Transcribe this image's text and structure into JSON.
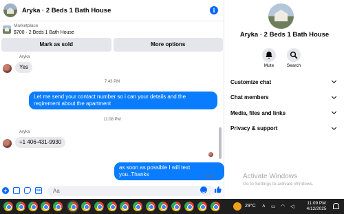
{
  "header": {
    "title": "Aryka · 2 Beds 1 Bath House",
    "info_icon": "info-icon"
  },
  "listing": {
    "source": "Marketplace",
    "summary": "$700 · 2 Beds 1 Bath House"
  },
  "actions": {
    "mark_sold": "Mark as sold",
    "more_options": "More options"
  },
  "messages": {
    "sender_1": "Aryka",
    "msg_1": "Yes",
    "time_1": "7:43 PM",
    "out_1": "Let me send your contact number so i can your details and the reqirement about the apartment",
    "time_2": "11:08 PM",
    "sender_2": "Aryka",
    "msg_2": "+1 406-431-9930",
    "out_2": "as soon as possible I will text you..Thanks",
    "status": "Sent"
  },
  "composer": {
    "placeholder": "Aa"
  },
  "details": {
    "title": "Aryka · 2 Beds 1 Bath House",
    "mute_label": "Mute",
    "search_label": "Search",
    "rows": [
      "Customize chat",
      "Chat members",
      "Media, files and links",
      "Privacy & support"
    ]
  },
  "watermark": {
    "title": "Activate Windows",
    "subtitle": "Go to Settings to activate Windows."
  },
  "taskbar": {
    "temperature": "29°C",
    "time": "11:09 PM",
    "date": "4/12/2025",
    "accent": "#1f1f1f"
  },
  "colors": {
    "accent": "#0866ff",
    "outgoing_bubble": "#0a7cff",
    "incoming_bubble": "#e9e9eb"
  }
}
